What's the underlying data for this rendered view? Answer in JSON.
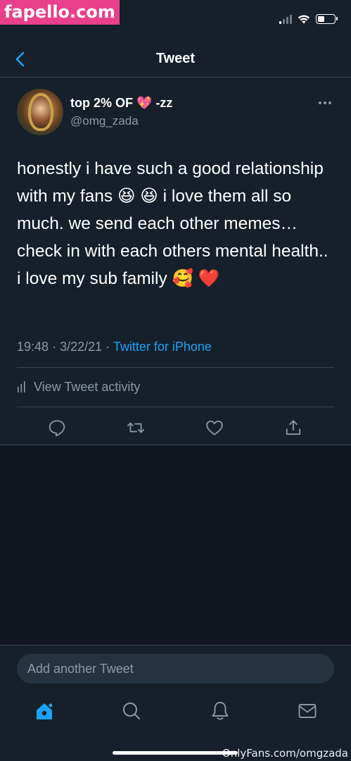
{
  "watermarks": {
    "top": "fapello.com",
    "bottom": "OnlyFans.com/omgzada"
  },
  "status_bar": {
    "signal_bars_on": 1,
    "battery_level": 0.4
  },
  "nav": {
    "title": "Tweet",
    "back_icon": "chevron-left-icon"
  },
  "author": {
    "display_name": "top 2% OF 💖 -zz",
    "handle": "@omg_zada"
  },
  "tweet": {
    "text": "honestly i have such a good relationship with my fans 😆 😆 i love them all so much. we send each other memes… check in with each others mental health.. i love my sub family 🥰 ❤️",
    "time": "19:48",
    "separator": "·",
    "date": "3/22/21",
    "source": "Twitter for iPhone"
  },
  "activity": {
    "label": "View Tweet activity",
    "icon": "activity-bars-icon"
  },
  "actions": [
    {
      "name": "reply",
      "icon": "reply-icon"
    },
    {
      "name": "retweet",
      "icon": "retweet-icon"
    },
    {
      "name": "like",
      "icon": "heart-icon"
    },
    {
      "name": "share",
      "icon": "share-icon"
    }
  ],
  "reply_box": {
    "placeholder": "Add another Tweet"
  },
  "tabbar": [
    {
      "name": "home",
      "icon": "home-icon",
      "active": true
    },
    {
      "name": "search",
      "icon": "search-icon",
      "active": false
    },
    {
      "name": "notifications",
      "icon": "bell-icon",
      "active": false
    },
    {
      "name": "messages",
      "icon": "mail-icon",
      "active": false
    }
  ],
  "colors": {
    "background": "#15202b",
    "accent": "#1da1f2",
    "secondary_text": "#8899a6",
    "watermark_pink": "#e8408a"
  }
}
